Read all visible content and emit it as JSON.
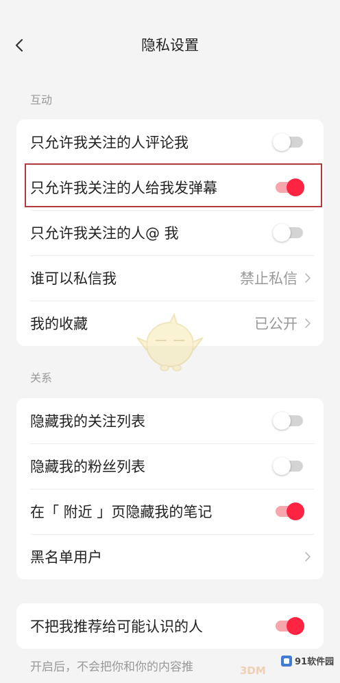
{
  "header": {
    "title": "隐私设置",
    "back_icon": "chevron-left-icon"
  },
  "interaction": {
    "title": "互动",
    "rows": [
      {
        "label": "只允许我关注的人评论我",
        "on": false
      },
      {
        "label": "只允许我关注的人给我发弹幕",
        "on": true,
        "highlighted": true
      },
      {
        "label": "只允许我关注的人@ 我",
        "on": false
      },
      {
        "label": "谁可以私信我",
        "value": "禁止私信",
        "icon": "chevron-right-icon"
      },
      {
        "label": "我的收藏",
        "value": "已公开",
        "icon": "chevron-right-icon"
      }
    ]
  },
  "relations": {
    "title": "关系",
    "rows": [
      {
        "label": "隐藏我的关注列表",
        "on": false
      },
      {
        "label": "隐藏我的粉丝列表",
        "on": false
      },
      {
        "label": "在「 附近 」页隐藏我的笔记",
        "on": true
      },
      {
        "label": "黑名单用户",
        "icon": "chevron-right-icon"
      }
    ]
  },
  "recommendation": {
    "rows": [
      {
        "label": "不把我推荐给可能认识的人",
        "on": true
      }
    ],
    "note": "开启后，不会把你和你的内容推"
  },
  "watermarks": {
    "site": "91软件园",
    "brand": "3DM"
  },
  "colors": {
    "accent": "#ff2442",
    "accent_track": "#f7a6ae",
    "highlight_box": "#b23a3f",
    "background": "#f4f4f4",
    "card": "#ffffff",
    "secondary_text": "#999999"
  }
}
